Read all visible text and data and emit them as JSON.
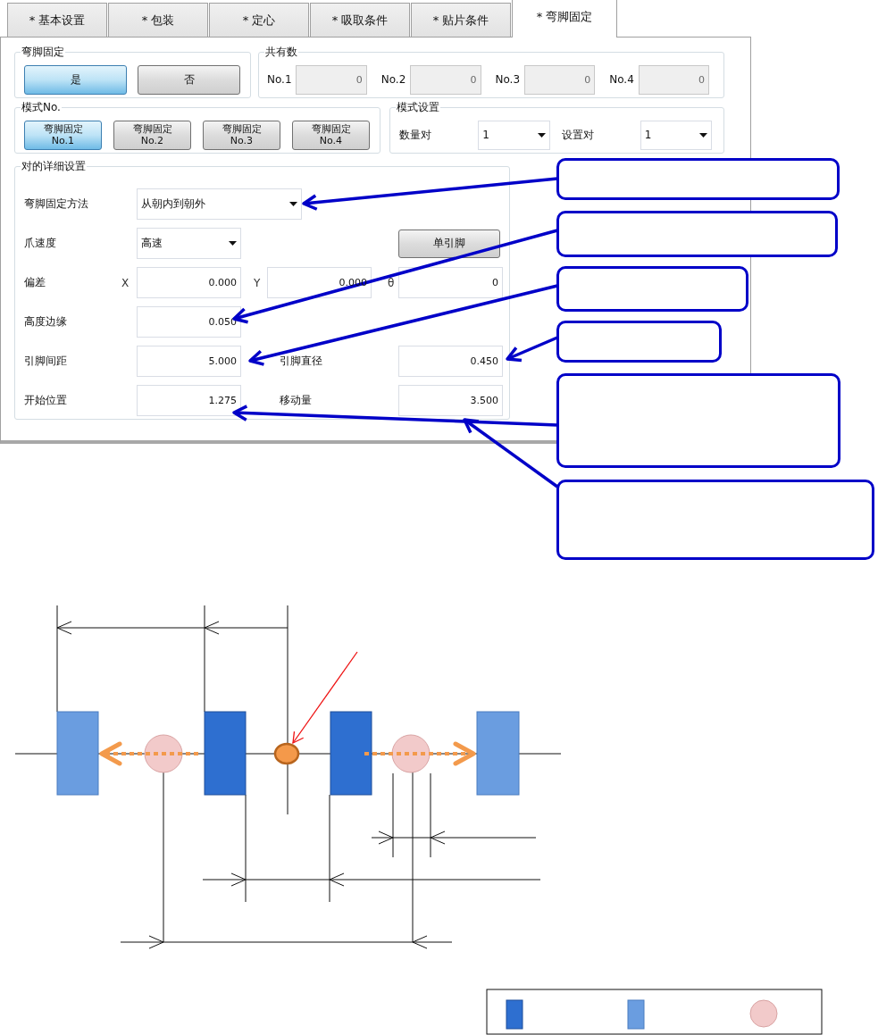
{
  "tabs": [
    {
      "label": "* 基本设置",
      "selected": false
    },
    {
      "label": "* 包装",
      "selected": false
    },
    {
      "label": "* 定心",
      "selected": false
    },
    {
      "label": "* 吸取条件",
      "selected": false
    },
    {
      "label": "* 贴片条件",
      "selected": false
    },
    {
      "label": "* 弯脚固定",
      "selected": true
    }
  ],
  "bend_fix": {
    "title": "弯脚固定",
    "options": [
      {
        "label": "是",
        "selected": true
      },
      {
        "label": "否",
        "selected": false
      }
    ]
  },
  "shared_count": {
    "title": "共有数",
    "fields": [
      {
        "label": "No.1",
        "value": "0",
        "disabled": true
      },
      {
        "label": "No.2",
        "value": "0",
        "disabled": true
      },
      {
        "label": "No.3",
        "value": "0",
        "disabled": true
      },
      {
        "label": "No.4",
        "value": "0",
        "disabled": true
      }
    ]
  },
  "pattern_no": {
    "title": "模式No.",
    "buttons": [
      {
        "label": "弯脚固定",
        "sublabel": "No.1",
        "selected": true
      },
      {
        "label": "弯脚固定",
        "sublabel": "No.2",
        "selected": false
      },
      {
        "label": "弯脚固定",
        "sublabel": "No.3",
        "selected": false
      },
      {
        "label": "弯脚固定",
        "sublabel": "No.4",
        "selected": false
      }
    ]
  },
  "pattern_settings": {
    "title": "模式设置",
    "fields": [
      {
        "label": "数量对",
        "value": "1"
      },
      {
        "label": "设置对",
        "value": "1"
      }
    ]
  },
  "pair_details": {
    "title": "对的详细设置",
    "method": {
      "label": "弯脚固定方法",
      "value": "从朝内到朝外"
    },
    "claw_speed": {
      "label": "爪速度",
      "value": "高速"
    },
    "single_lead_button": "单引脚",
    "offset": {
      "label": "偏差",
      "fields": [
        {
          "axis": "X",
          "value": "0.000"
        },
        {
          "axis": "Y",
          "value": "0.000"
        },
        {
          "axis": "θ",
          "value": "0"
        }
      ]
    },
    "height_margin": {
      "label": "高度边缘",
      "value": "0.050"
    },
    "lead_pitch": {
      "label": "引脚间距",
      "value": "5.000"
    },
    "lead_diameter": {
      "label": "引脚直径",
      "value": "0.450"
    },
    "start_position": {
      "label": "开始位置",
      "value": "1.275"
    },
    "move_amount": {
      "label": "移动量",
      "value": "3.500"
    }
  }
}
